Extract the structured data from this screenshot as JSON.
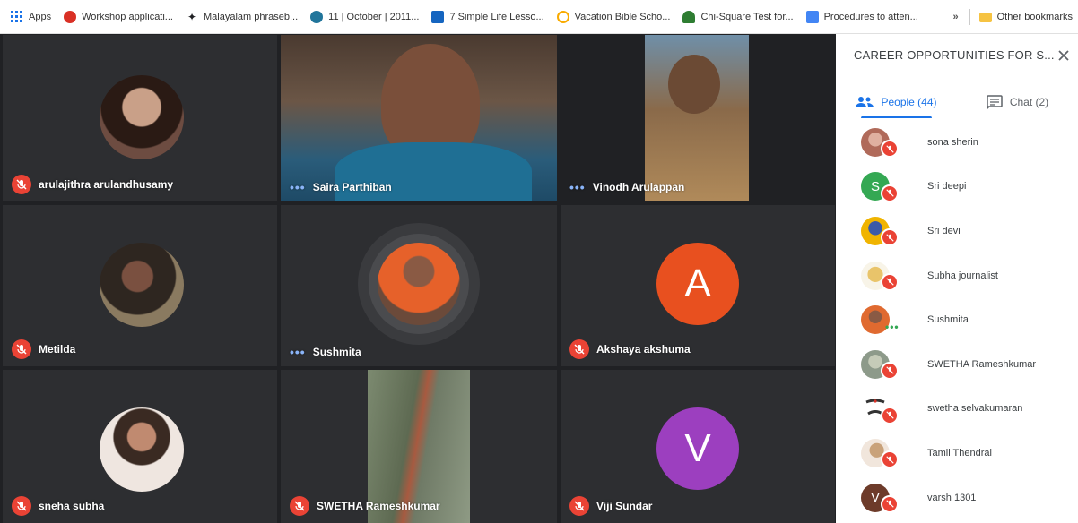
{
  "bookmarks": {
    "items": [
      {
        "label": "Apps",
        "icon": "apps-icon",
        "color": "#1a73e8"
      },
      {
        "label": "Workshop applicati...",
        "icon": "workshop-icon",
        "color": "#d93025"
      },
      {
        "label": "Malayalam phraseb...",
        "icon": "compass-icon",
        "color": "#202124"
      },
      {
        "label": "11 | October | 2011...",
        "icon": "wordpress-icon",
        "color": "#21759b"
      },
      {
        "label": "7 Simple Life Lesso...",
        "icon": "bookmark-page-icon",
        "color": "#1565c0"
      },
      {
        "label": "Vacation Bible Scho...",
        "icon": "leaf-icon",
        "color": "#f9ab00"
      },
      {
        "label": "Chi-Square Test for...",
        "icon": "stats-icon",
        "color": "#2e7d32"
      },
      {
        "label": "Procedures to atten...",
        "icon": "whs-icon",
        "color": "#4285f4"
      }
    ],
    "overflow_label": "»",
    "other_label": "Other bookmarks"
  },
  "tiles": [
    {
      "name": "arulajithra arulandhusamy",
      "status": "muted",
      "kind": "photo-avatar",
      "color": "#6d4c41"
    },
    {
      "name": "Saira Parthiban",
      "status": "speaking",
      "kind": "video",
      "color": "#5d6a73"
    },
    {
      "name": "Vinodh Arulappan",
      "status": "speaking",
      "kind": "video",
      "color": "#8a6a4a"
    },
    {
      "name": "Metilda",
      "status": "muted",
      "kind": "photo-avatar",
      "color": "#7a6555"
    },
    {
      "name": "Sushmita",
      "status": "speaking",
      "kind": "photo-avatar",
      "color": "#e64a19"
    },
    {
      "name": "Akshaya akshuma",
      "status": "muted",
      "kind": "letter-avatar",
      "letter": "A",
      "color": "#e8501f"
    },
    {
      "name": "sneha subha",
      "status": "muted",
      "kind": "photo-avatar",
      "color": "#d7b8a8"
    },
    {
      "name": "SWETHA Rameshkumar",
      "status": "muted",
      "kind": "video",
      "color": "#6f7a66"
    },
    {
      "name": "Viji Sundar",
      "status": "muted",
      "kind": "letter-avatar",
      "letter": "V",
      "color": "#9c3fbf"
    }
  ],
  "panel": {
    "title": "CAREER OPPORTUNITIES FOR S...",
    "tabs": [
      {
        "label": "People (44)",
        "icon": "people-icon",
        "active": true
      },
      {
        "label": "Chat (2)",
        "icon": "chat-icon",
        "active": false
      }
    ],
    "participants": [
      {
        "name": "sona sherin",
        "status": "muted",
        "avatar": "photo",
        "color": "#b06a5a"
      },
      {
        "name": "Sri deepi",
        "status": "muted",
        "avatar": "letter",
        "letter": "S",
        "color": "#34a853"
      },
      {
        "name": "Sri devi",
        "status": "muted",
        "avatar": "photo",
        "color": "#f0b400"
      },
      {
        "name": "Subha journalist",
        "status": "muted",
        "avatar": "photo",
        "color": "#e9c46a"
      },
      {
        "name": "Sushmita",
        "status": "speaking",
        "avatar": "photo",
        "color": "#e06a30"
      },
      {
        "name": "SWETHA Rameshkumar",
        "status": "muted",
        "avatar": "photo",
        "color": "#8d9a8a"
      },
      {
        "name": "swetha selvakumaran",
        "status": "muted",
        "avatar": "photo",
        "color": "#333333"
      },
      {
        "name": "Tamil Thendral",
        "status": "muted",
        "avatar": "photo",
        "color": "#c9a27a"
      },
      {
        "name": "varsh 1301",
        "status": "muted",
        "avatar": "letter",
        "letter": "V",
        "color": "#6d3b2a"
      }
    ]
  },
  "colors": {
    "muted": "#ea4335",
    "accent": "#1a73e8",
    "background": "#202124"
  }
}
